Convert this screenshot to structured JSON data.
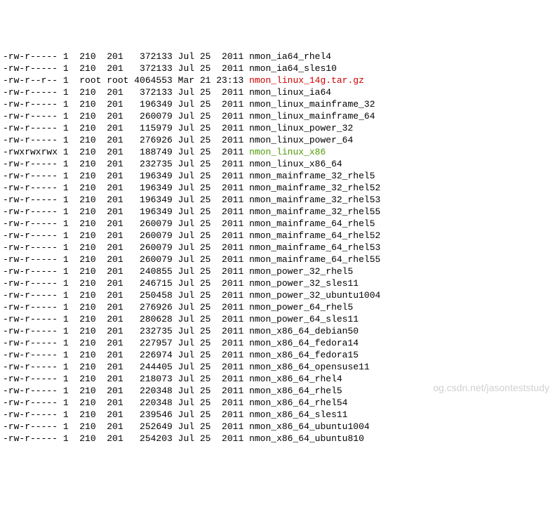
{
  "listing": [
    {
      "perms": "-rw-r-----",
      "links": "1",
      "owner": "210",
      "group": "201",
      "size": "372133",
      "month": "Jul",
      "day": "25",
      "time": "2011",
      "name": "nmon_ia64_rhel4",
      "color": "normal"
    },
    {
      "perms": "-rw-r-----",
      "links": "1",
      "owner": "210",
      "group": "201",
      "size": "372133",
      "month": "Jul",
      "day": "25",
      "time": "2011",
      "name": "nmon_ia64_sles10",
      "color": "normal"
    },
    {
      "perms": "-rw-r--r--",
      "links": "1",
      "owner": "root",
      "group": "root",
      "size": "4064553",
      "month": "Mar",
      "day": "21",
      "time": "23:13",
      "name": "nmon_linux_14g.tar.gz",
      "color": "red"
    },
    {
      "perms": "-rw-r-----",
      "links": "1",
      "owner": "210",
      "group": "201",
      "size": "372133",
      "month": "Jul",
      "day": "25",
      "time": "2011",
      "name": "nmon_linux_ia64",
      "color": "normal"
    },
    {
      "perms": "-rw-r-----",
      "links": "1",
      "owner": "210",
      "group": "201",
      "size": "196349",
      "month": "Jul",
      "day": "25",
      "time": "2011",
      "name": "nmon_linux_mainframe_32",
      "color": "normal"
    },
    {
      "perms": "-rw-r-----",
      "links": "1",
      "owner": "210",
      "group": "201",
      "size": "260079",
      "month": "Jul",
      "day": "25",
      "time": "2011",
      "name": "nmon_linux_mainframe_64",
      "color": "normal"
    },
    {
      "perms": "-rw-r-----",
      "links": "1",
      "owner": "210",
      "group": "201",
      "size": "115979",
      "month": "Jul",
      "day": "25",
      "time": "2011",
      "name": "nmon_linux_power_32",
      "color": "normal"
    },
    {
      "perms": "-rw-r-----",
      "links": "1",
      "owner": "210",
      "group": "201",
      "size": "276926",
      "month": "Jul",
      "day": "25",
      "time": "2011",
      "name": "nmon_linux_power_64",
      "color": "normal"
    },
    {
      "perms": "-rwxrwxrwx",
      "links": "1",
      "owner": "210",
      "group": "201",
      "size": "188749",
      "month": "Jul",
      "day": "25",
      "time": "2011",
      "name": "nmon_linux_x86",
      "color": "green"
    },
    {
      "perms": "-rw-r-----",
      "links": "1",
      "owner": "210",
      "group": "201",
      "size": "232735",
      "month": "Jul",
      "day": "25",
      "time": "2011",
      "name": "nmon_linux_x86_64",
      "color": "normal"
    },
    {
      "perms": "-rw-r-----",
      "links": "1",
      "owner": "210",
      "group": "201",
      "size": "196349",
      "month": "Jul",
      "day": "25",
      "time": "2011",
      "name": "nmon_mainframe_32_rhel5",
      "color": "normal"
    },
    {
      "perms": "-rw-r-----",
      "links": "1",
      "owner": "210",
      "group": "201",
      "size": "196349",
      "month": "Jul",
      "day": "25",
      "time": "2011",
      "name": "nmon_mainframe_32_rhel52",
      "color": "normal"
    },
    {
      "perms": "-rw-r-----",
      "links": "1",
      "owner": "210",
      "group": "201",
      "size": "196349",
      "month": "Jul",
      "day": "25",
      "time": "2011",
      "name": "nmon_mainframe_32_rhel53",
      "color": "normal"
    },
    {
      "perms": "-rw-r-----",
      "links": "1",
      "owner": "210",
      "group": "201",
      "size": "196349",
      "month": "Jul",
      "day": "25",
      "time": "2011",
      "name": "nmon_mainframe_32_rhel55",
      "color": "normal"
    },
    {
      "perms": "-rw-r-----",
      "links": "1",
      "owner": "210",
      "group": "201",
      "size": "260079",
      "month": "Jul",
      "day": "25",
      "time": "2011",
      "name": "nmon_mainframe_64_rhel5",
      "color": "normal"
    },
    {
      "perms": "-rw-r-----",
      "links": "1",
      "owner": "210",
      "group": "201",
      "size": "260079",
      "month": "Jul",
      "day": "25",
      "time": "2011",
      "name": "nmon_mainframe_64_rhel52",
      "color": "normal"
    },
    {
      "perms": "-rw-r-----",
      "links": "1",
      "owner": "210",
      "group": "201",
      "size": "260079",
      "month": "Jul",
      "day": "25",
      "time": "2011",
      "name": "nmon_mainframe_64_rhel53",
      "color": "normal"
    },
    {
      "perms": "-rw-r-----",
      "links": "1",
      "owner": "210",
      "group": "201",
      "size": "260079",
      "month": "Jul",
      "day": "25",
      "time": "2011",
      "name": "nmon_mainframe_64_rhel55",
      "color": "normal"
    },
    {
      "perms": "-rw-r-----",
      "links": "1",
      "owner": "210",
      "group": "201",
      "size": "240855",
      "month": "Jul",
      "day": "25",
      "time": "2011",
      "name": "nmon_power_32_rhel5",
      "color": "normal"
    },
    {
      "perms": "-rw-r-----",
      "links": "1",
      "owner": "210",
      "group": "201",
      "size": "246715",
      "month": "Jul",
      "day": "25",
      "time": "2011",
      "name": "nmon_power_32_sles11",
      "color": "normal"
    },
    {
      "perms": "-rw-r-----",
      "links": "1",
      "owner": "210",
      "group": "201",
      "size": "250458",
      "month": "Jul",
      "day": "25",
      "time": "2011",
      "name": "nmon_power_32_ubuntu1004",
      "color": "normal"
    },
    {
      "perms": "-rw-r-----",
      "links": "1",
      "owner": "210",
      "group": "201",
      "size": "276926",
      "month": "Jul",
      "day": "25",
      "time": "2011",
      "name": "nmon_power_64_rhel5",
      "color": "normal"
    },
    {
      "perms": "-rw-r-----",
      "links": "1",
      "owner": "210",
      "group": "201",
      "size": "280628",
      "month": "Jul",
      "day": "25",
      "time": "2011",
      "name": "nmon_power_64_sles11",
      "color": "normal"
    },
    {
      "perms": "-rw-r-----",
      "links": "1",
      "owner": "210",
      "group": "201",
      "size": "232735",
      "month": "Jul",
      "day": "25",
      "time": "2011",
      "name": "nmon_x86_64_debian50",
      "color": "normal"
    },
    {
      "perms": "-rw-r-----",
      "links": "1",
      "owner": "210",
      "group": "201",
      "size": "227957",
      "month": "Jul",
      "day": "25",
      "time": "2011",
      "name": "nmon_x86_64_fedora14",
      "color": "normal"
    },
    {
      "perms": "-rw-r-----",
      "links": "1",
      "owner": "210",
      "group": "201",
      "size": "226974",
      "month": "Jul",
      "day": "25",
      "time": "2011",
      "name": "nmon_x86_64_fedora15",
      "color": "normal"
    },
    {
      "perms": "-rw-r-----",
      "links": "1",
      "owner": "210",
      "group": "201",
      "size": "244405",
      "month": "Jul",
      "day": "25",
      "time": "2011",
      "name": "nmon_x86_64_opensuse11",
      "color": "normal"
    },
    {
      "perms": "-rw-r-----",
      "links": "1",
      "owner": "210",
      "group": "201",
      "size": "218073",
      "month": "Jul",
      "day": "25",
      "time": "2011",
      "name": "nmon_x86_64_rhel4",
      "color": "normal"
    },
    {
      "perms": "-rw-r-----",
      "links": "1",
      "owner": "210",
      "group": "201",
      "size": "220348",
      "month": "Jul",
      "day": "25",
      "time": "2011",
      "name": "nmon_x86_64_rhel5",
      "color": "normal"
    },
    {
      "perms": "-rw-r-----",
      "links": "1",
      "owner": "210",
      "group": "201",
      "size": "220348",
      "month": "Jul",
      "day": "25",
      "time": "2011",
      "name": "nmon_x86_64_rhel54",
      "color": "normal"
    },
    {
      "perms": "-rw-r-----",
      "links": "1",
      "owner": "210",
      "group": "201",
      "size": "239546",
      "month": "Jul",
      "day": "25",
      "time": "2011",
      "name": "nmon_x86_64_sles11",
      "color": "normal"
    },
    {
      "perms": "-rw-r-----",
      "links": "1",
      "owner": "210",
      "group": "201",
      "size": "252649",
      "month": "Jul",
      "day": "25",
      "time": "2011",
      "name": "nmon_x86_64_ubuntu1004",
      "color": "normal"
    },
    {
      "perms": "-rw-r-----",
      "links": "1",
      "owner": "210",
      "group": "201",
      "size": "254203",
      "month": "Jul",
      "day": "25",
      "time": "2011",
      "name": "nmon_x86_64_ubuntu810",
      "color": "normal"
    }
  ],
  "watermark": "og.csdn.net/jasonteststudy"
}
